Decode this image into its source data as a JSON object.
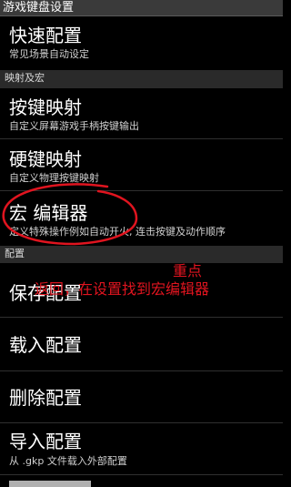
{
  "window": {
    "title": "游戏键盘设置"
  },
  "items": [
    {
      "title": "快速配置",
      "subtitle": "常见场景自动设定"
    },
    {
      "title": "按键映射",
      "subtitle": "自定义屏幕游戏手柄按键输出"
    },
    {
      "title": "硬键映射",
      "subtitle": "自定义物理按键映射"
    },
    {
      "title": "宏 编辑器",
      "subtitle": "定义特殊操作例如自动开火, 连击按键及动作顺序"
    },
    {
      "title": "保存配置",
      "subtitle": ""
    },
    {
      "title": "载入配置",
      "subtitle": ""
    },
    {
      "title": "删除配置",
      "subtitle": ""
    },
    {
      "title": "导入配置",
      "subtitle": "从 .gkp 文件载入外部配置"
    }
  ],
  "sections": [
    {
      "label": "映射及宏"
    },
    {
      "label": "配置"
    }
  ],
  "annotations": {
    "key_point": "重点",
    "instruction": "返回，在设置找到宏编辑器",
    "color": "#e0141f"
  },
  "colors": {
    "background": "#000000",
    "section_header": "#2a2a2a",
    "title_bar": "#3a3a3a",
    "text": "#ffffff",
    "subtext": "#d0d0d0"
  }
}
